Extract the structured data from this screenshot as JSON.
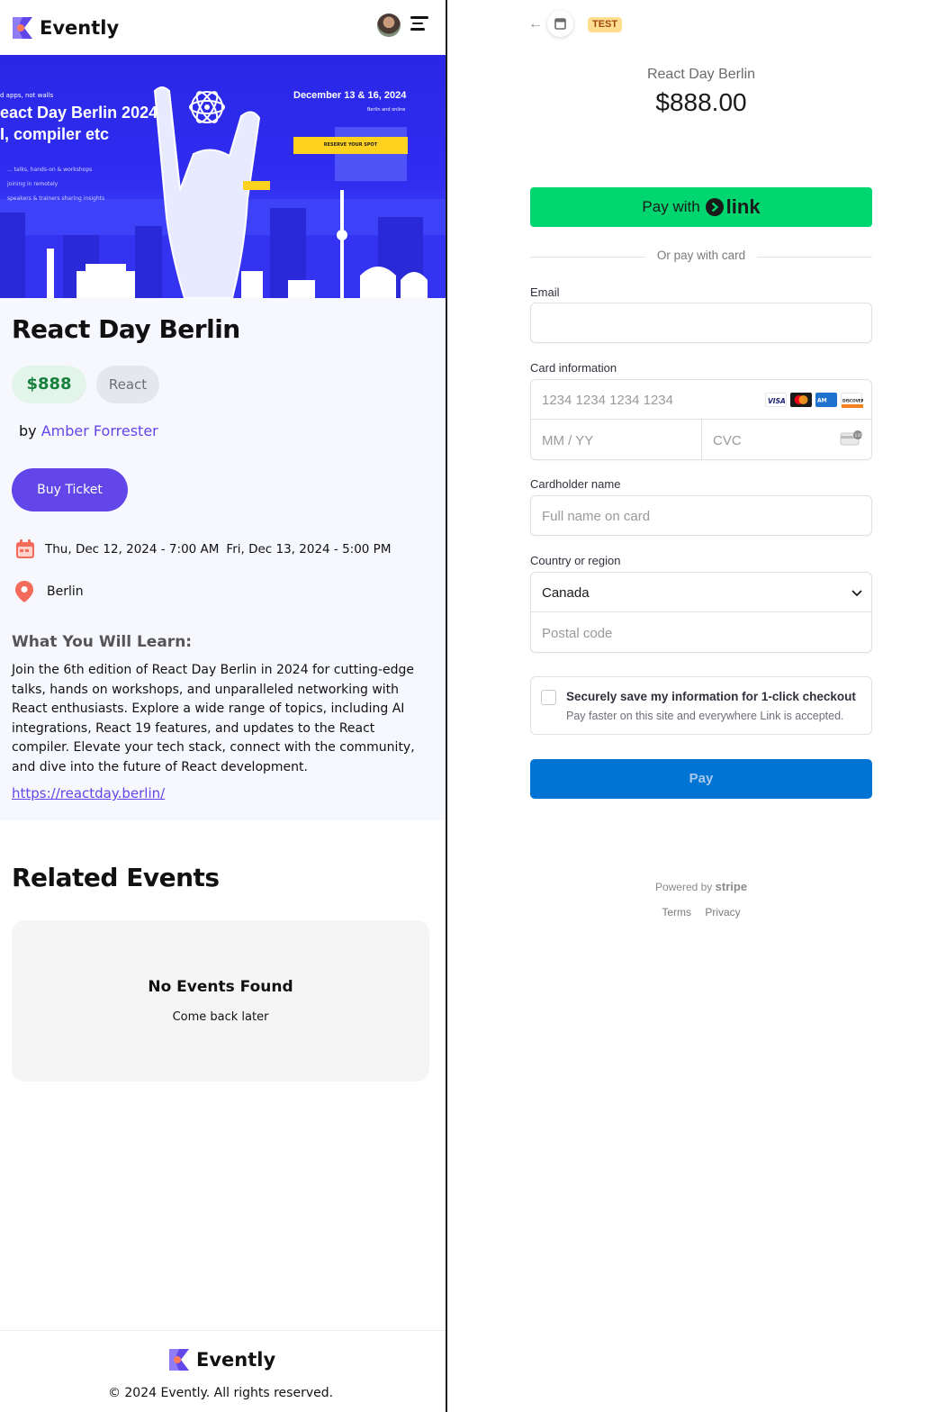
{
  "app": {
    "name": "Evently"
  },
  "icons": {
    "logo": "evently-logo-icon",
    "menu": "hamburger-menu-icon",
    "calendar": "calendar-icon",
    "location": "location-pin-icon",
    "back": "back-arrow-icon",
    "store": "store-icon",
    "chevron": "chevron-down-icon",
    "card_cvc": "cvc-card-icon"
  },
  "colors": {
    "primary": "#6246ea",
    "link_green": "#00d66f",
    "pay_blue": "#0074d4",
    "price_green": "#17803d"
  },
  "banner": {
    "tagline": "d apps, not walls",
    "title_line1": "eact Day Berlin 2024",
    "title_line2": "I, compiler etc",
    "bullets": [
      "... talks, hands-on & workshops",
      "joining in remotely",
      "speakers & trainers sharing insights"
    ],
    "date": "December 13 & 16, 2024",
    "where": "Berlin and online",
    "cta": "RESERVE YOUR SPOT"
  },
  "event": {
    "title": "React Day Berlin",
    "price": "$888",
    "category": "React",
    "by_label": "by",
    "organizer": "Amber Forrester",
    "buy_label": "Buy Ticket",
    "start": "Thu, Dec 12, 2024 - 7:00 AM",
    "end": "Fri, Dec 13, 2024 - 5:00 PM",
    "location": "Berlin",
    "learn_heading": "What You Will Learn:",
    "description": "Join the 6th edition of React Day Berlin in 2024 for cutting-edge talks, hands on workshops, and unparalleled networking with React enthusiasts. Explore a wide range of topics, including AI integrations, React 19 features, and updates to the React compiler. Elevate your tech stack, connect with the community, and dive into the future of React development.",
    "url": "https://reactday.berlin/"
  },
  "related": {
    "heading": "Related Events",
    "empty_title": "No Events Found",
    "empty_sub": "Come back later"
  },
  "footer": {
    "brand": "Evently",
    "copyright": "© 2024 Evently. All rights reserved."
  },
  "checkout": {
    "test_badge": "TEST",
    "merchant": "React Day Berlin",
    "amount": "$888.00",
    "link_button_prefix": "Pay with",
    "link_button_brand": "link",
    "or_text": "Or pay with card",
    "email_label": "Email",
    "email_value": "",
    "card_label": "Card information",
    "card_number_placeholder": "1234 1234 1234 1234",
    "card_brands": [
      "VISA",
      "Mastercard",
      "AMEX",
      "DISCOVER"
    ],
    "expiry_placeholder": "MM / YY",
    "cvc_placeholder": "CVC",
    "name_label": "Cardholder name",
    "name_placeholder": "Full name on card",
    "country_label": "Country or region",
    "country_value": "Canada",
    "postal_placeholder": "Postal code",
    "save_title": "Securely save my information for 1-click checkout",
    "save_sub": "Pay faster on this site and everywhere Link is accepted.",
    "pay_label": "Pay",
    "powered_by": "Powered by",
    "powered_brand": "stripe",
    "terms": "Terms",
    "privacy": "Privacy"
  }
}
